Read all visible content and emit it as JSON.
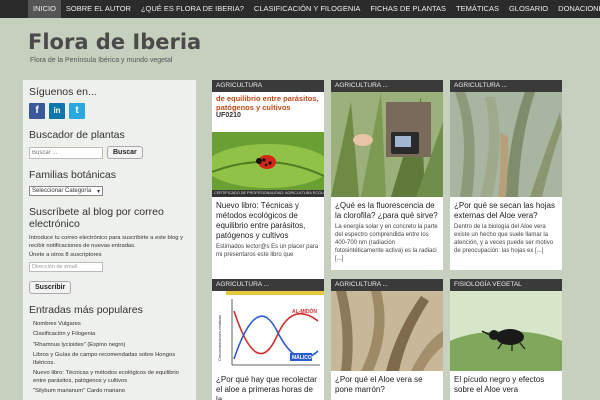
{
  "nav": {
    "items": [
      "INICIO",
      "SOBRE EL AUTOR",
      "¿QUÉ ES FLORA DE IBERIA?",
      "CLASIFICACIÓN Y FILOGENIA",
      "FICHAS DE PLANTAS",
      "TEMÁTICAS",
      "GLOSARIO",
      "DONACIONES"
    ]
  },
  "site": {
    "title": "Flora de Iberia",
    "tagline": "Flora de la Península Ibérica y mundo vegetal"
  },
  "sidebar": {
    "social_heading": "Síguenos en...",
    "social": {
      "fb": "f",
      "li": "in",
      "tw": "t"
    },
    "search_heading": "Buscador de plantas",
    "search_placeholder": "Buscar ...",
    "search_button": "Buscar",
    "families_heading": "Familias botánicas",
    "families_select": "Seleccionar Categoría",
    "subscribe_heading": "Suscríbete al blog por correo electrónico",
    "subscribe_text": "Introduce tu correo electrónico para suscribirte a este blog y recibir notificaciones de nuevas entradas.",
    "subscribe_count": "Únete a otros 8 suscriptores",
    "email_placeholder": "Dirección de email",
    "subscribe_button": "Suscribir",
    "popular_heading": "Entradas más populares",
    "popular": [
      "Nombres Vulgares",
      "Clasificación y Filogenia",
      "\"Rhamnus lycioides\" (Espino negro)",
      "Libros y Guías de campo recomendadas sobre Hongos Ibéricos.",
      "Nuevo libro: Técnicas y métodos ecológicos de equilibrio entre parásitos, patógenos y cultivos",
      "\"Silybum marianum\" Cardo mariano"
    ]
  },
  "cards": [
    {
      "category": "AGRICULTURA",
      "title": "Nuevo libro: Técnicas y métodos ecológicos de equilibrio entre parásitos, patógenos y cultivos",
      "excerpt": "Estimados lector@s Es un placer para mi presentaros este libro que",
      "book": {
        "line1": "de equilibrio entre parásitos,",
        "line2": "patógenos y cultivos",
        "code": "UF0210",
        "footer": "CERTIFICADO DE PROFESIONALIDAD: AGRICULTURA ECOLÓGICA"
      }
    },
    {
      "category": "AGRICULTURA  ...",
      "title": "¿Qué es la fluorescencia de la clorofila? ¿para qué sirve?",
      "excerpt": "La energía solar y en concreto la parte del espectro comprendida entre los 400-700 nm (radiación fotosintéticamente activa) es la radiaci [...]"
    },
    {
      "category": "AGRICULTURA  ...",
      "title": "¿Por qué se secan las hojas externas del Aloe vera?",
      "excerpt": "Dentro de la biología del Aloe vera existe un hecho que suele llamar la atención, y a veces puede ser motivo de preocupación: las hojas ex [...]"
    },
    {
      "category": "AGRICULTURA  ...",
      "title": "¿Por qué hay que recolectar el aloe a primeras horas de la",
      "chart": {
        "ylabel": "Concentraciones relativas",
        "label_am": "AL-MIDÓN",
        "label_malico": "MÁLICO"
      }
    },
    {
      "category": "AGRICULTURA  ...",
      "title": "¿Por qué el Aloe vera se pone marrón?"
    },
    {
      "category": "FISIOLOGÍA VEGETAL",
      "title": "El pícudo negro y efectos sobre el Aloe vera"
    }
  ]
}
